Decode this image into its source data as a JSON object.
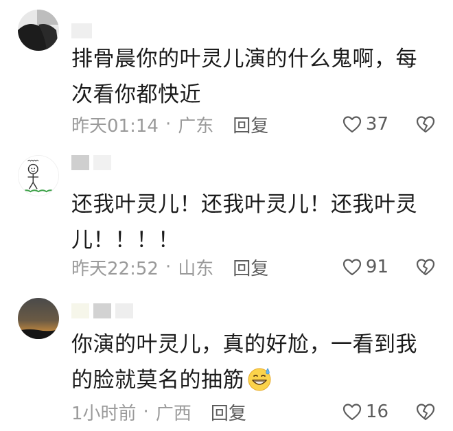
{
  "comments": [
    {
      "text": "排骨晨你的叶灵儿演的什么鬼啊，每次看你都快近",
      "time": "昨天01:14",
      "location": "广东",
      "reply_label": "回复",
      "likes": "37",
      "avatar_icon": "dark-photo-avatar-icon"
    },
    {
      "text": "还我叶灵儿！还我叶灵儿！还我叶灵儿！！！！",
      "time": "昨天22:52",
      "location": "山东",
      "reply_label": "回复",
      "likes": "91",
      "avatar_icon": "stick-figure-avatar-icon"
    },
    {
      "text": "你演的叶灵儿，真的好尬，一看到我的脸就莫名的抽筋",
      "emoji": "grinning-sweat-emoji",
      "time": "1小时前",
      "location": "广西",
      "reply_label": "回复",
      "likes": "16",
      "avatar_icon": "night-sky-avatar-icon"
    }
  ],
  "separator": "·",
  "colors": {
    "text": "#1b1b1b",
    "meta": "#9a9a9a",
    "action": "#5c5c5c"
  }
}
